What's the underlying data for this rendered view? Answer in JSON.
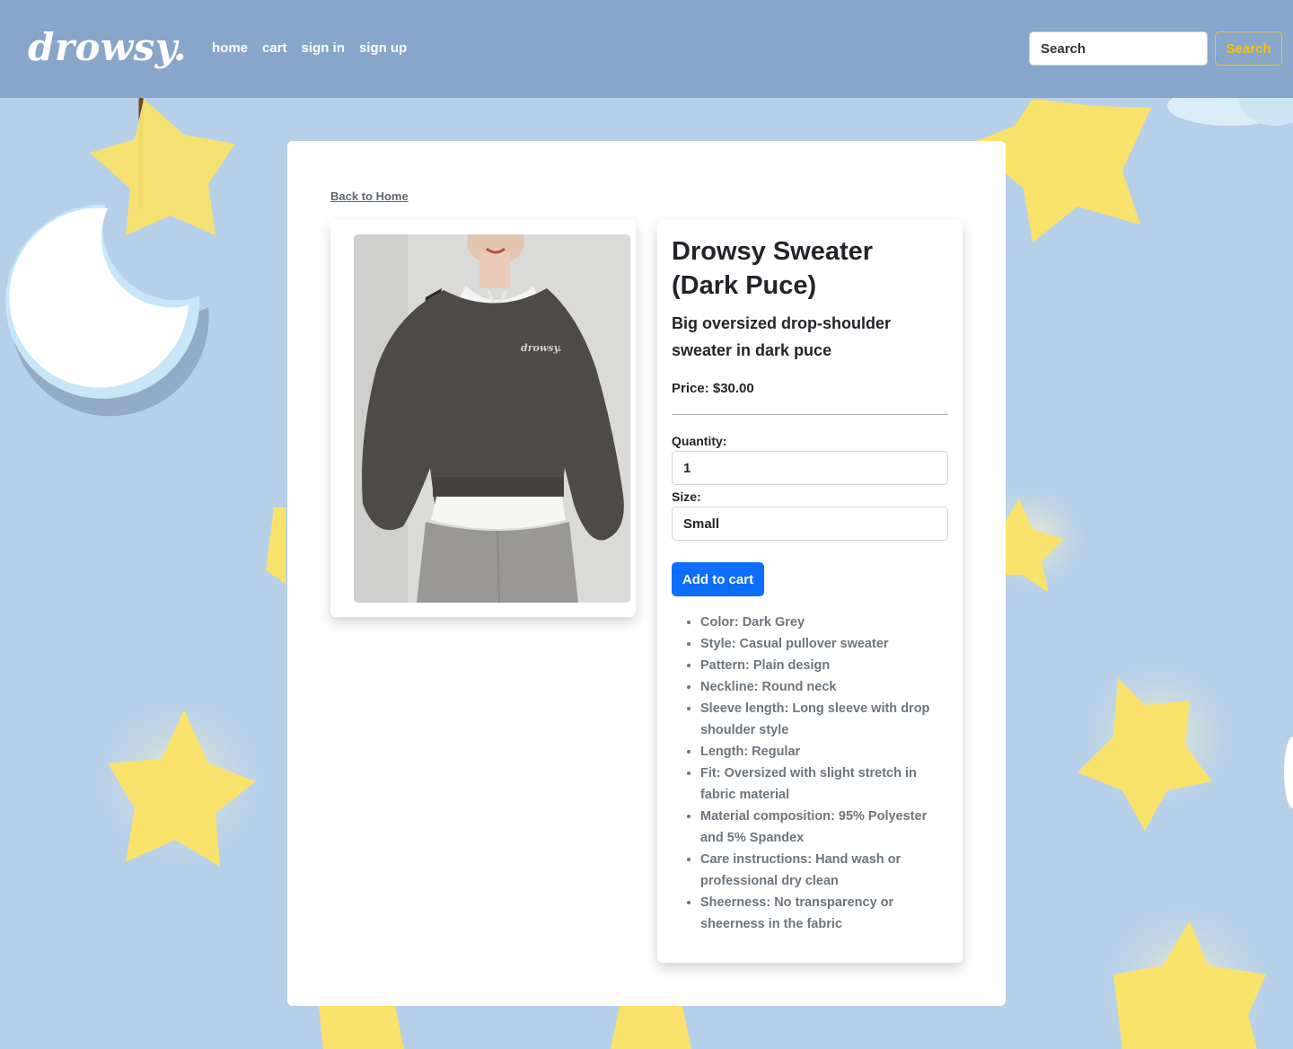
{
  "navbar": {
    "brand": "drowsy.",
    "links": [
      "home",
      "cart",
      "sign in",
      "sign up"
    ],
    "search_placeholder": "Search",
    "search_button": "Search"
  },
  "page": {
    "back_link": "Back to Home"
  },
  "product": {
    "title": "Drowsy Sweater (Dark Puce)",
    "subtitle": "Big oversized drop-shoulder sweater in dark puce",
    "price_label": "Price: $30.00",
    "image_logo_text": "drowsy.",
    "quantity_label": "Quantity:",
    "quantity_value": "1",
    "size_label": "Size:",
    "size_value": "Small",
    "add_to_cart": "Add to cart",
    "features": [
      "Color: Dark Grey",
      "Style: Casual pullover sweater",
      "Pattern: Plain design",
      "Neckline: Round neck",
      "Sleeve length: Long sleeve with drop shoulder style",
      "Length: Regular",
      "Fit: Oversized with slight stretch in fabric material",
      "Material composition: 95% Polyester and 5% Spandex",
      "Care instructions: Hand wash or professional dry clean",
      "Sheerness: No transparency or sheerness in the fabric"
    ]
  },
  "colors": {
    "navbar_bg": "#87a6ca",
    "page_bg": "#b6d0e9",
    "star": "#f9e26b",
    "search_accent": "#ffc107",
    "primary_button": "#0d6efd"
  },
  "icons": [
    "moon-icon",
    "star-icon"
  ]
}
